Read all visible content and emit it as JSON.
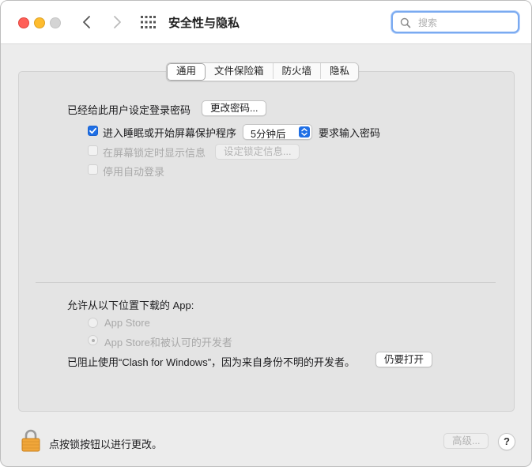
{
  "window": {
    "title": "安全性与隐私",
    "search_placeholder": "搜索"
  },
  "tabs": [
    {
      "label": "通用",
      "active": true
    },
    {
      "label": "文件保险箱",
      "active": false
    },
    {
      "label": "防火墙",
      "active": false
    },
    {
      "label": "隐私",
      "active": false
    }
  ],
  "general": {
    "password_set_label": "已经给此用户设定登录密码",
    "change_password_button": "更改密码...",
    "require_password": {
      "checked": true,
      "prefix": "进入睡眠或开始屏幕保护程序",
      "delay_value": "5分钟后",
      "suffix": "要求输入密码"
    },
    "show_message": {
      "checked": false,
      "label": "在屏幕锁定时显示信息",
      "button": "设定锁定信息..."
    },
    "disable_auto_login": {
      "checked": false,
      "label": "停用自动登录"
    },
    "download_section_label": "允许从以下位置下载的 App:",
    "download_options": [
      {
        "label": "App Store",
        "selected": false
      },
      {
        "label": "App Store和被认可的开发者",
        "selected": true
      }
    ],
    "blocked_message": "已阻止使用“Clash for Windows”，因为来自身份不明的开发者。",
    "open_anyway_button": "仍要打开"
  },
  "footer": {
    "lock_text": "点按锁按钮以进行更改。",
    "advanced_button": "高级...",
    "help_button": "?"
  },
  "colors": {
    "accent": "#1f6fe5",
    "close": "#ff5f57",
    "minimize": "#febc2e",
    "lock": "#f0a63a"
  }
}
